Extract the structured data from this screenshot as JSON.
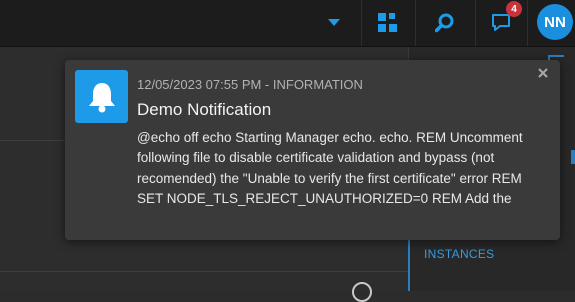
{
  "header": {
    "notifications_badge": "4",
    "avatar_initials": "NN",
    "icons": {
      "dropdown": "caret-down-icon",
      "apps": "grid-icon",
      "search": "search-icon",
      "notifications": "chat-bubble-icon"
    }
  },
  "sidebar_right": {
    "instances_label": "INSTANCES"
  },
  "notification": {
    "meta": "12/05/2023 07:55 PM - INFORMATION",
    "title": "Demo Notification",
    "body": "@echo off echo Starting Manager echo. echo. REM Uncomment following file to disable certificate validation and bypass (not recomended) the \"Unable to verify the first certificate\" error REM SET NODE_TLS_REJECT_UNAUTHORIZED=0 REM Add the",
    "icon": "bell-icon",
    "close_icon": "close-icon"
  },
  "colors": {
    "accent": "#1e9be8",
    "badge": "#c8333b",
    "topbar": "#1c1c1c",
    "toast_bg": "#3a3a3a"
  }
}
